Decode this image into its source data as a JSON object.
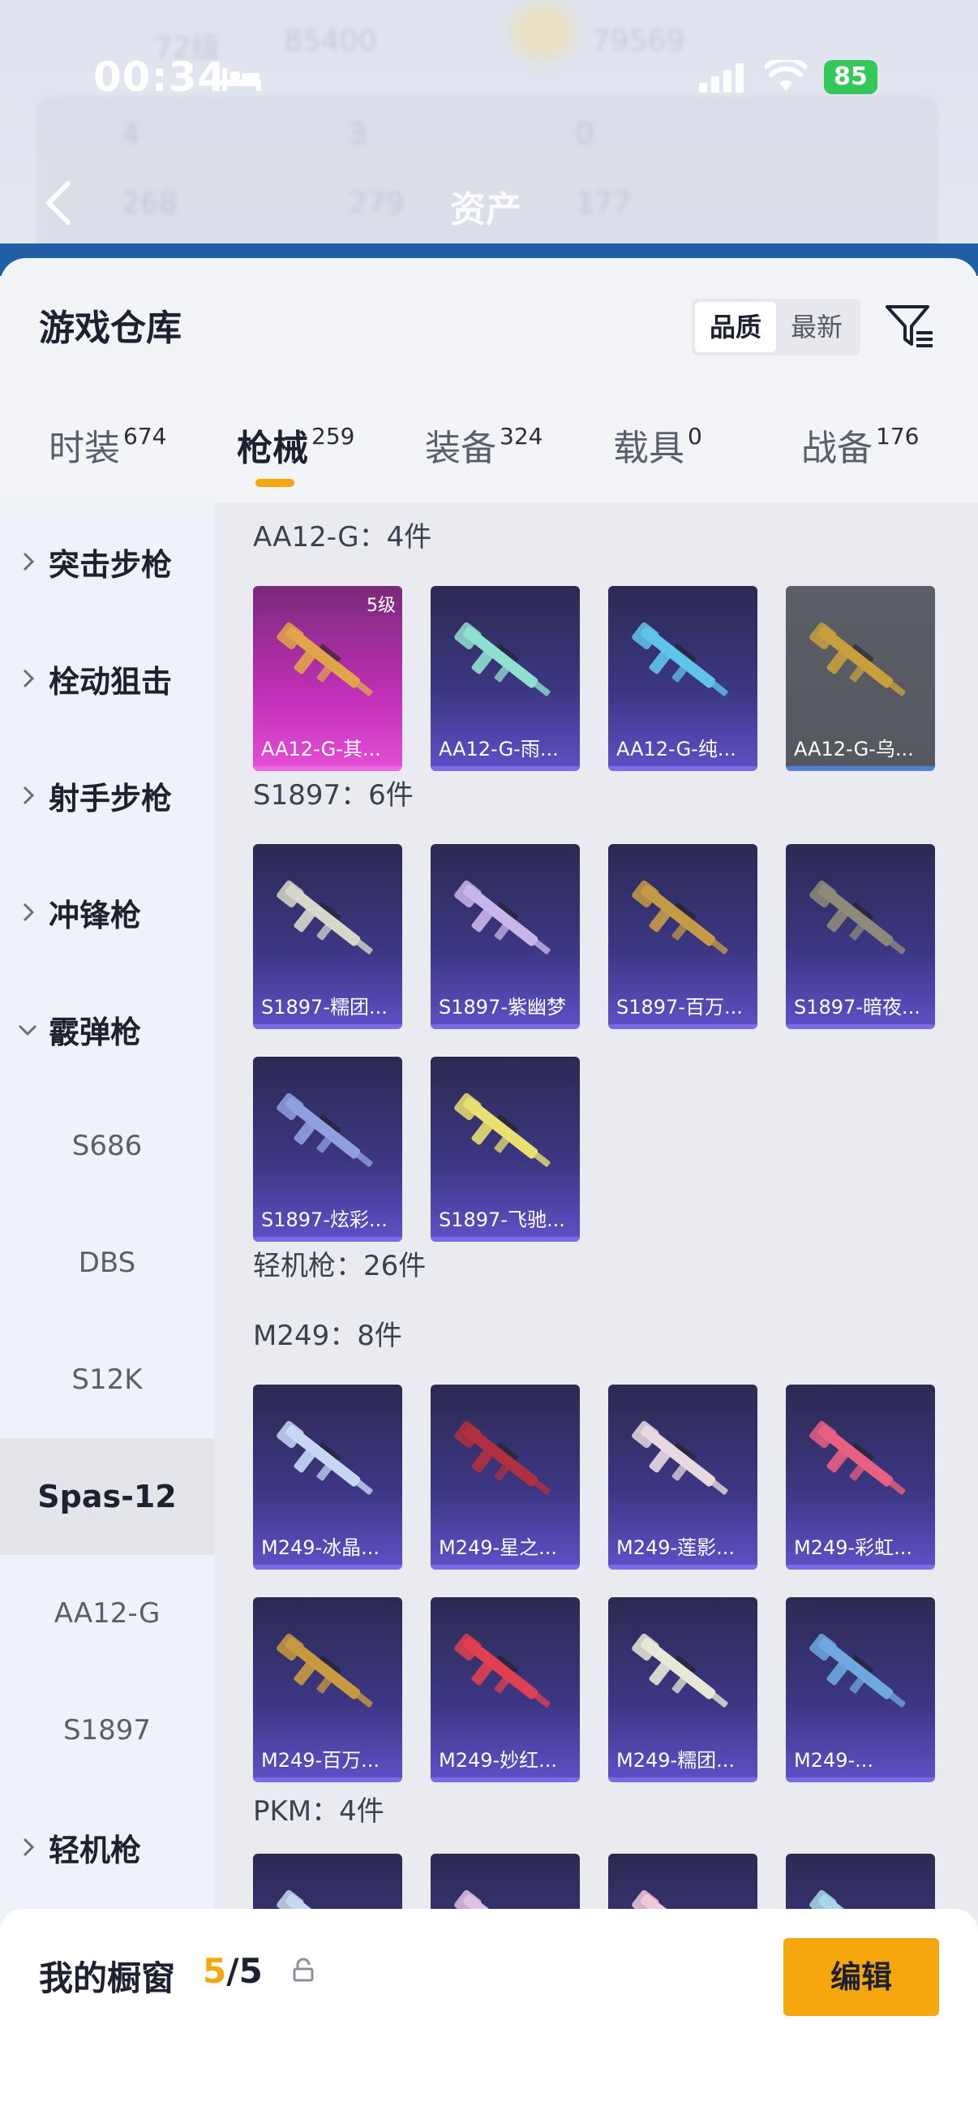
{
  "status_bar": {
    "time": "00:34",
    "battery": "85"
  },
  "background_header": {
    "level": "72级",
    "coins": "85400",
    "score": "79569",
    "stat_a": "4",
    "stat_b": "3",
    "stat_c": "0",
    "stat_d": "268",
    "stat_e": "279",
    "stat_f": "177"
  },
  "nav": {
    "title": "资产"
  },
  "sheet": {
    "title": "游戏仓库",
    "sort_options": [
      "品质",
      "最新"
    ],
    "sort_active": "品质"
  },
  "tabs": [
    {
      "label": "时装",
      "count": "674"
    },
    {
      "label": "枪械",
      "count": "259",
      "active": true
    },
    {
      "label": "装备",
      "count": "324"
    },
    {
      "label": "载具",
      "count": "0"
    },
    {
      "label": "战备",
      "count": "176"
    }
  ],
  "sidebar": [
    {
      "label": "突击步枪",
      "type": "category",
      "expanded": false
    },
    {
      "label": "栓动狙击",
      "type": "category",
      "expanded": false
    },
    {
      "label": "射手步枪",
      "type": "category",
      "expanded": false
    },
    {
      "label": "冲锋枪",
      "type": "category",
      "expanded": false
    },
    {
      "label": "霰弹枪",
      "type": "category",
      "expanded": true
    },
    {
      "label": "S686",
      "type": "sub"
    },
    {
      "label": "DBS",
      "type": "sub"
    },
    {
      "label": "S12K",
      "type": "sub"
    },
    {
      "label": "Spas-12",
      "type": "sub",
      "selected": true
    },
    {
      "label": "AA12-G",
      "type": "sub"
    },
    {
      "label": "S1897",
      "type": "sub"
    },
    {
      "label": "轻机枪",
      "type": "category",
      "expanded": false
    }
  ],
  "groups": {
    "aa12": {
      "title": "AA12-G：4件",
      "items": [
        {
          "name": "AA12-G-其...",
          "rarity": "pink",
          "level": "5级",
          "gun_color": "#e0a44b"
        },
        {
          "name": "AA12-G-雨...",
          "rarity": "purple",
          "gun_color": "#8fe0d0"
        },
        {
          "name": "AA12-G-纯...",
          "rarity": "purple",
          "gun_color": "#5fc4ea"
        },
        {
          "name": "AA12-G-乌...",
          "rarity": "grey",
          "gun_color": "#c7a03c"
        }
      ]
    },
    "s1897": {
      "title": "S1897：6件",
      "items": [
        {
          "name": "S1897-糯团...",
          "gun_color": "#d7d8c8"
        },
        {
          "name": "S1897-紫幽梦",
          "gun_color": "#c9b6e8"
        },
        {
          "name": "S1897-百万...",
          "gun_color": "#c59a45"
        },
        {
          "name": "S1897-暗夜...",
          "gun_color": "#8e8a7a"
        },
        {
          "name": "S1897-炫彩...",
          "gun_color": "#8fa0e0"
        },
        {
          "name": "S1897-飞驰...",
          "gun_color": "#e8e070"
        }
      ]
    },
    "lmg": {
      "title": "轻机枪：26件"
    },
    "m249": {
      "title": "M249：8件",
      "items": [
        {
          "name": "M249-冰晶...",
          "gun_color": "#c6d8f5"
        },
        {
          "name": "M249-星之...",
          "gun_color": "#b03040"
        },
        {
          "name": "M249-莲影...",
          "gun_color": "#e8d8e0"
        },
        {
          "name": "M249-彩虹...",
          "gun_color": "#e86080"
        },
        {
          "name": "M249-百万...",
          "gun_color": "#c89a40"
        },
        {
          "name": "M249-妙红...",
          "gun_color": "#e04050"
        },
        {
          "name": "M249-糯团...",
          "gun_color": "#e8e8d8"
        },
        {
          "name": "M249-...",
          "gun_color": "#6fa8e0"
        }
      ]
    },
    "pkm": {
      "title": "PKM：4件",
      "items": [
        {
          "gun_color": "#c8d8f0"
        },
        {
          "gun_color": "#e0c0e8"
        },
        {
          "gun_color": "#f0c8d8"
        },
        {
          "gun_color": "#a8d8e8"
        }
      ]
    }
  },
  "bottom": {
    "showcase_label": "我的橱窗",
    "showcase_current": "5",
    "showcase_sep": "/",
    "showcase_total": "5",
    "edit_label": "编辑"
  },
  "icons": {
    "back": "chevron-left-icon",
    "filter": "filter-icon",
    "share": "share-icon",
    "lock": "lock-icon",
    "expand": "chevron-right-icon",
    "collapse": "chevron-down-icon"
  }
}
